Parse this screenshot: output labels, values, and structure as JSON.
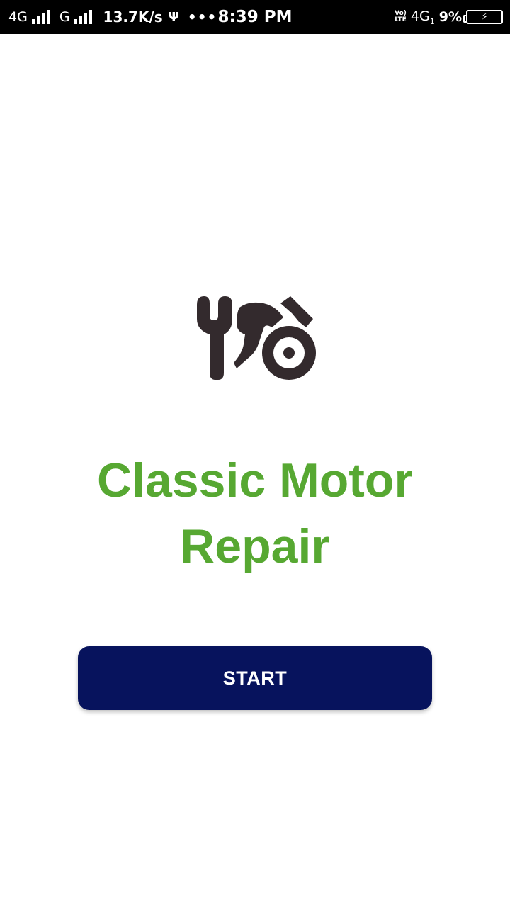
{
  "status_bar": {
    "network_1": "4G",
    "network_2": "G",
    "speed": "13.7K/s",
    "usb_icon": "usb-icon",
    "more": "•••",
    "time": "8:39 PM",
    "volte_top": "Vo)",
    "volte_bottom": "LTE",
    "network_3": "4G",
    "network_3_sub": "1",
    "battery_percent": "9%",
    "battery_icon": "battery-charging-icon"
  },
  "app": {
    "logo_icon": "motorcycle-wrench-icon",
    "title_line1": "Classic Motor",
    "title_line2": "Repair",
    "start_label": "START"
  },
  "colors": {
    "title": "#57a832",
    "button": "#07135d",
    "logo": "#332a2d",
    "status_bar": "#000000"
  }
}
